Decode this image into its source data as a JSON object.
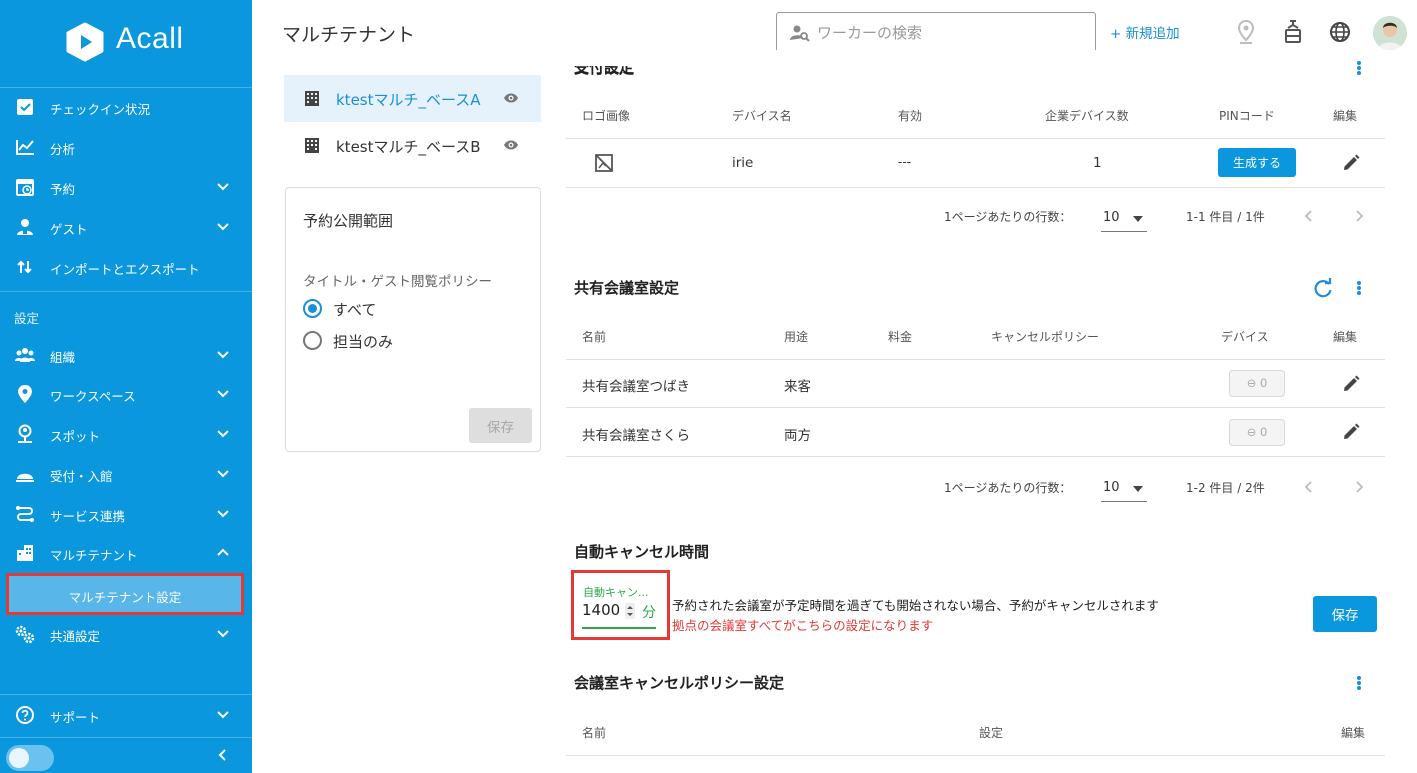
{
  "app": {
    "brand": "Acall",
    "page_title": "マルチテナント"
  },
  "sidebar": {
    "items": [
      {
        "label": "チェックイン状況",
        "icon": "checkbox-icon"
      },
      {
        "label": "分析",
        "icon": "chart-line-icon"
      },
      {
        "label": "予約",
        "icon": "calendar-clock-icon"
      },
      {
        "label": "ゲスト",
        "icon": "guest-icon"
      },
      {
        "label": "インポートとエクスポート",
        "icon": "import-export-icon"
      }
    ],
    "section_label": "設定",
    "settings_items": [
      {
        "label": "組織",
        "icon": "people-icon"
      },
      {
        "label": "ワークスペース",
        "icon": "location-pin-icon"
      },
      {
        "label": "スポット",
        "icon": "person-pin-icon"
      },
      {
        "label": "受付・入館",
        "icon": "reception-bell-icon"
      },
      {
        "label": "サービス連携",
        "icon": "integration-icon"
      },
      {
        "label": "マルチテナント",
        "icon": "building-icon"
      }
    ],
    "sub_item": "マルチテナント設定",
    "common_settings": "共通設定",
    "support": "サポート"
  },
  "header": {
    "search_placeholder": "ワーカーの検索",
    "add_new": "+ 新規追加"
  },
  "bases": [
    {
      "name": "ktestマルチ_ベースA",
      "active": true
    },
    {
      "name": "ktestマルチ_ベースB",
      "active": false
    }
  ],
  "reservation_scope": {
    "title": "予約公開範囲",
    "subtitle": "タイトル・ゲスト閲覧ポリシー",
    "options": [
      "すべて",
      "担当のみ"
    ],
    "selected": "すべて",
    "save": "保存"
  },
  "reception": {
    "title": "受付設定",
    "columns": [
      "ロゴ画像",
      "デバイス名",
      "有効",
      "企業デバイス数",
      "PINコード",
      "編集"
    ],
    "rows": [
      {
        "device_name": "irie",
        "enabled": "---",
        "count": "1",
        "pin_button": "生成する"
      }
    ],
    "pagination": {
      "rows_per_page_label": "1ページあたりの行数：",
      "rows_per_page": "10",
      "range": "1-1 件目 / 1件"
    }
  },
  "shared_rooms": {
    "title": "共有会議室設定",
    "columns": [
      "名前",
      "用途",
      "料金",
      "キャンセルポリシー",
      "デバイス",
      "編集"
    ],
    "rows": [
      {
        "name": "共有会議室つばき",
        "usage": "来客",
        "devices": "0"
      },
      {
        "name": "共有会議室さくら",
        "usage": "両方",
        "devices": "0"
      }
    ],
    "pagination": {
      "rows_per_page_label": "1ページあたりの行数：",
      "rows_per_page": "10",
      "range": "1-2 件目 / 2件"
    }
  },
  "auto_cancel": {
    "title": "自動キャンセル時間",
    "field_label": "自動キャン...",
    "value": "1400",
    "unit": "分",
    "description": "予約された会議室が予定時間を過ぎても開始されない場合、予約がキャンセルされます",
    "note": "拠点の会議室すべてがこちらの設定になります",
    "save": "保存"
  },
  "cancel_policy": {
    "title": "会議室キャンセルポリシー設定",
    "columns": [
      "名前",
      "設定",
      "編集"
    ]
  },
  "colors": {
    "sidebar": "#0a97dd",
    "accent": "#1a8fd8",
    "highlight_border": "#e53935",
    "field_green": "#2ea84a",
    "note_red": "#e53935"
  }
}
